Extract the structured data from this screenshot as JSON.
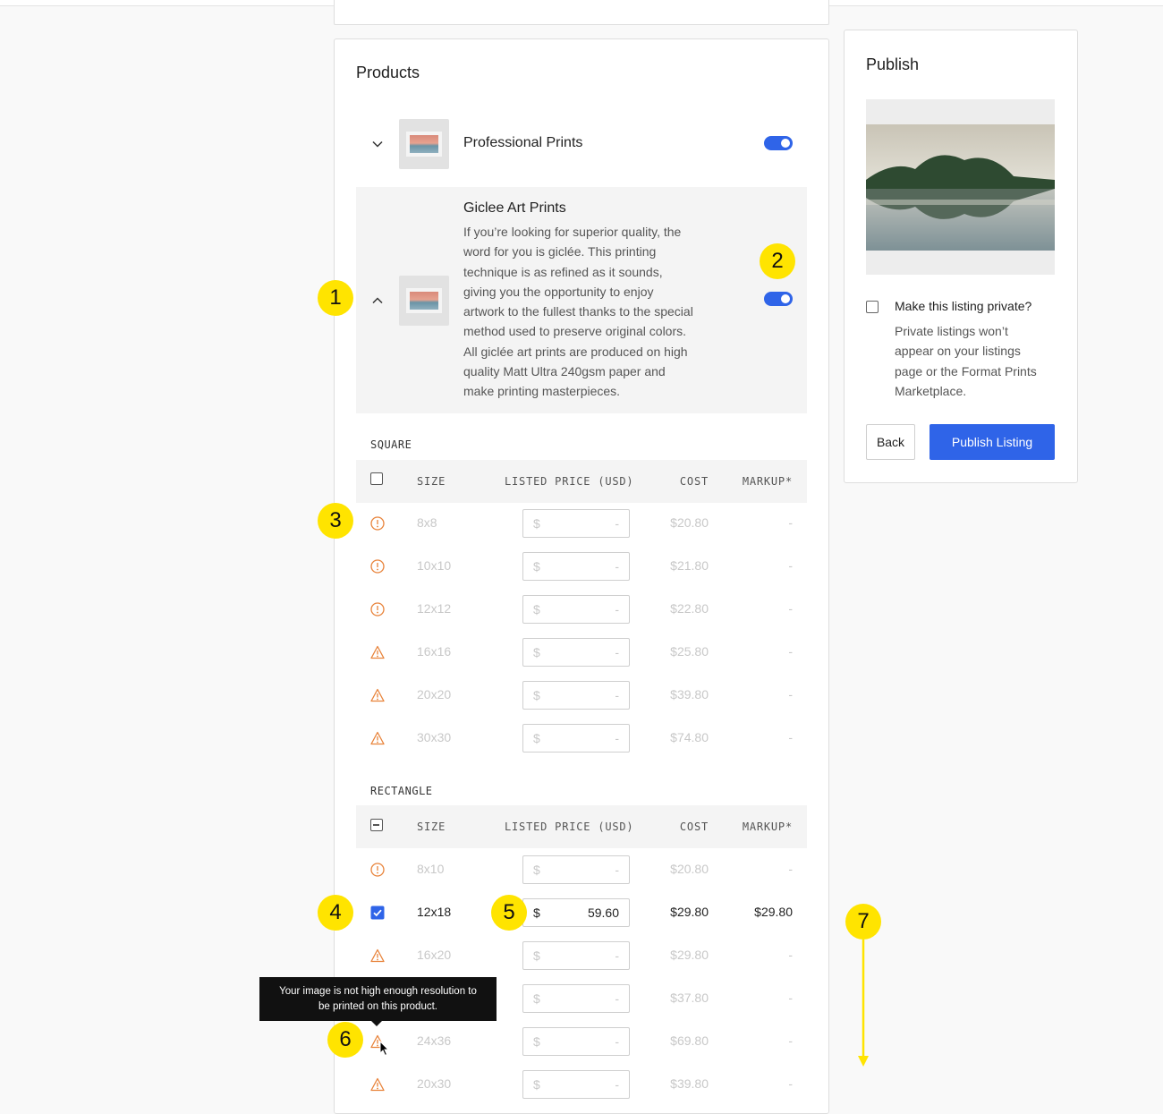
{
  "products": {
    "title": "Products",
    "professional": {
      "name": "Professional Prints"
    },
    "giclee": {
      "name": "Giclee Art Prints",
      "description_lines": [
        "If you’re looking for superior quality, the",
        "word for you is giclée. This printing",
        "technique is as refined as it sounds,",
        "giving you the opportunity to enjoy",
        "artwork to the fullest thanks to the special",
        "method used to preserve original colors.",
        "All giclée art prints are produced on high",
        "quality Matt Ultra 240gsm paper and",
        "make printing masterpieces."
      ]
    },
    "headers": {
      "size": "SIZE",
      "price": "LISTED PRICE (USD)",
      "cost": "COST",
      "markup": "MARKUP*"
    },
    "square": {
      "label": "SQUARE",
      "rows": [
        {
          "icon": "info-circle-icon",
          "size": "8x8",
          "currency": "$",
          "price": "-",
          "cost": "$20.80",
          "markup": "-"
        },
        {
          "icon": "info-circle-icon",
          "size": "10x10",
          "currency": "$",
          "price": "-",
          "cost": "$21.80",
          "markup": "-"
        },
        {
          "icon": "info-circle-icon",
          "size": "12x12",
          "currency": "$",
          "price": "-",
          "cost": "$22.80",
          "markup": "-"
        },
        {
          "icon": "warning-triangle-icon",
          "size": "16x16",
          "currency": "$",
          "price": "-",
          "cost": "$25.80",
          "markup": "-"
        },
        {
          "icon": "warning-triangle-icon",
          "size": "20x20",
          "currency": "$",
          "price": "-",
          "cost": "$39.80",
          "markup": "-"
        },
        {
          "icon": "warning-triangle-icon",
          "size": "30x30",
          "currency": "$",
          "price": "-",
          "cost": "$74.80",
          "markup": "-"
        }
      ]
    },
    "rectangle": {
      "label": "RECTANGLE",
      "rows": [
        {
          "icon": "info-circle-icon",
          "size": "8x10",
          "currency": "$",
          "price": "-",
          "cost": "$20.80",
          "markup": "-"
        },
        {
          "icon": "checkbox-checked",
          "size": "12x18",
          "currency": "$",
          "price": "59.60",
          "cost": "$29.80",
          "markup": "$29.80"
        },
        {
          "icon": "warning-triangle-icon",
          "size": "16x20",
          "currency": "$",
          "price": "-",
          "cost": "$29.80",
          "markup": "-"
        },
        {
          "icon": "warning-triangle-icon",
          "size": "",
          "currency": "$",
          "price": "-",
          "cost": "$37.80",
          "markup": "-"
        },
        {
          "icon": "warning-triangle-icon",
          "size": "24x36",
          "currency": "$",
          "price": "-",
          "cost": "$69.80",
          "markup": "-"
        },
        {
          "icon": "warning-triangle-icon",
          "size": "20x30",
          "currency": "$",
          "price": "-",
          "cost": "$39.80",
          "markup": "-"
        }
      ]
    }
  },
  "publish": {
    "title": "Publish",
    "private_label": "Make this listing private?",
    "private_help_lines": [
      "Private listings won’t",
      "appear on your listings",
      "page or the Format Prints",
      "Marketplace."
    ],
    "back_label": "Back",
    "publish_label": "Publish Listing"
  },
  "tooltip": {
    "line1": "Your image is not high enough resolution to",
    "line2": "be printed on this product."
  },
  "markers": [
    "1",
    "2",
    "3",
    "4",
    "5",
    "6",
    "7"
  ],
  "colors": {
    "accent": "#2f64e8",
    "warning": "#e8833a",
    "marker": "#ffe400"
  }
}
